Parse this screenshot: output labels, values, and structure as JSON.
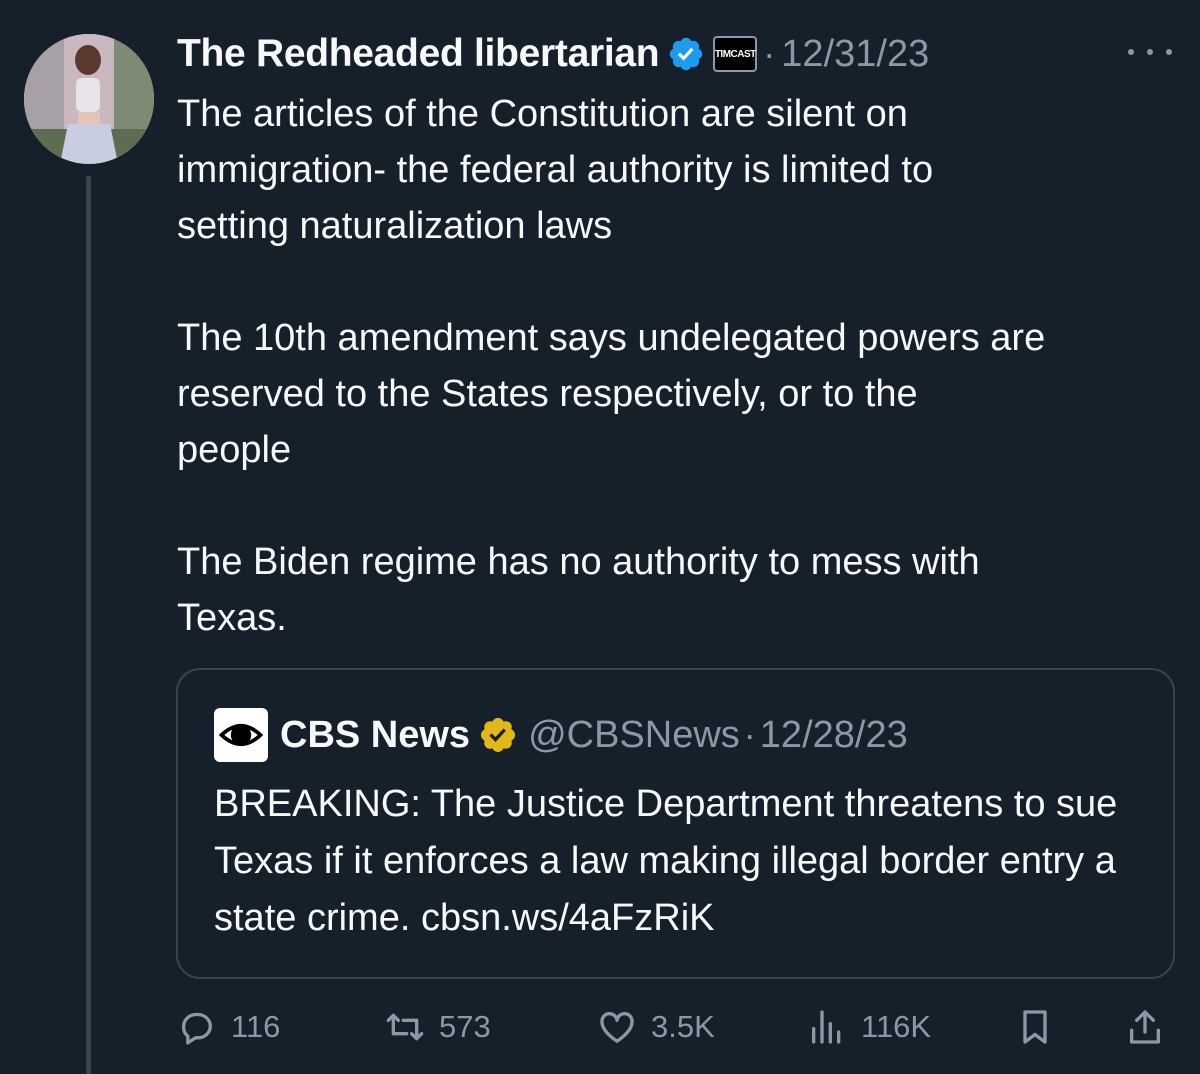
{
  "tweet": {
    "display_name": "The Redheaded libertarian",
    "affiliation_badge": "TIMCAST",
    "separator": "·",
    "date": "12/31/23",
    "text": "The articles of the Constitution are silent on\nimmigration- the federal authority is limited to\nsetting naturalization laws\n\nThe 10th amendment says undelegated powers are\nreserved to the States respectively, or to the\npeople\n\nThe Biden regime has no authority to mess with\nTexas."
  },
  "quote": {
    "display_name": "CBS News",
    "handle": "@CBSNews",
    "separator": "·",
    "date": "12/28/23",
    "text": "BREAKING: The Justice Department threatens to sue Texas if it enforces a law making illegal border entry a state crime.  cbsn.ws/4aFzRiK"
  },
  "actions": {
    "replies": "116",
    "reposts": "573",
    "likes": "3.5K",
    "views": "116K"
  },
  "colors": {
    "background": "#15202b",
    "text": "#f7f9f9",
    "muted": "#8b98a5",
    "border": "#38444d",
    "verified_blue": "#1d9bf0",
    "verified_gold": "#e2b719"
  },
  "icons": [
    "more-icon",
    "verified-blue-icon",
    "verified-gold-icon",
    "cbs-eye-logo",
    "reply-icon",
    "repost-icon",
    "like-icon",
    "views-icon",
    "bookmark-icon",
    "share-icon"
  ]
}
